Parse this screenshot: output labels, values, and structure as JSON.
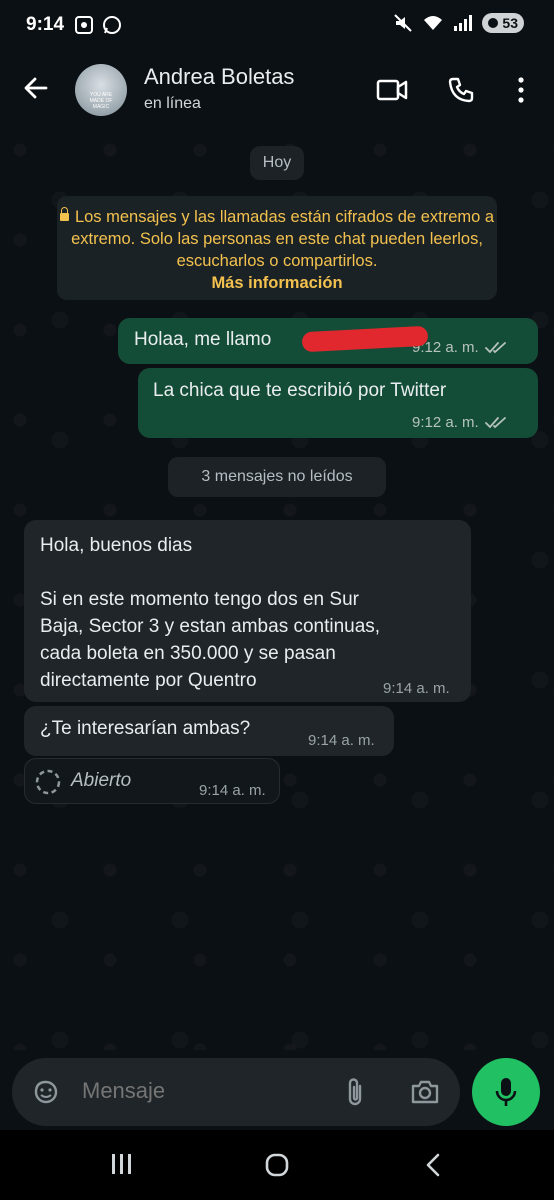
{
  "status_bar": {
    "time": "9:14",
    "battery": "53",
    "wifi_label": "5"
  },
  "header": {
    "contact_name": "Andrea Boletas",
    "contact_status": "en línea",
    "avatar_text": "YOU ARE MADE OF MAGIC"
  },
  "chat": {
    "date_label": "Hoy",
    "encryption_notice": "Los mensajes y las llamadas están cifrados de extremo a extremo. Solo las personas en este chat pueden leerlos, escucharlos o compartirlos.",
    "encryption_link": "Más información",
    "unread_label": "3 mensajes no leídos",
    "messages": [
      {
        "direction": "out",
        "text": "Holaa, me llamo",
        "time": "9:12 a. m."
      },
      {
        "direction": "out",
        "text": "La chica que te escribió por Twitter",
        "time": "9:12 a. m."
      },
      {
        "direction": "in",
        "text_line1": "Hola, buenos dias",
        "text_line2": "Si en este momento tengo dos en Sur",
        "text_line3": "Baja, Sector 3 y estan ambas continuas,",
        "text_line4": "cada boleta en 350.000 y se pasan",
        "text_line5": "directamente por Quentro",
        "time": "9:14 a. m."
      },
      {
        "direction": "in",
        "text": "¿Te interesarían ambas?",
        "time": "9:14 a. m."
      },
      {
        "direction": "in",
        "text": "Abierto",
        "time": "9:14 a. m."
      }
    ]
  },
  "composer": {
    "placeholder": "Mensaje"
  },
  "colors": {
    "outgoing_bubble": "#144d37",
    "incoming_bubble": "#1f2528",
    "accent_green": "#21c063",
    "encryption_text": "#f3c14e"
  }
}
